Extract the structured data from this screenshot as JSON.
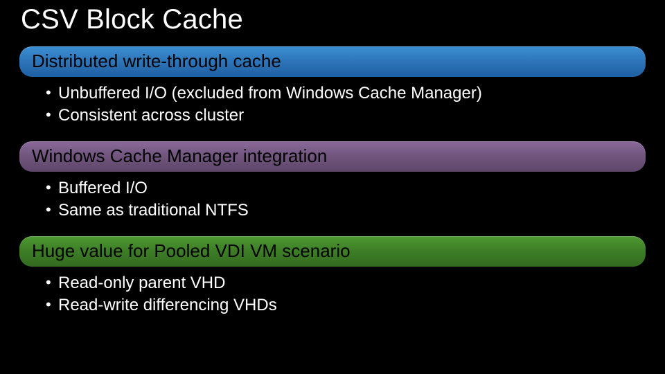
{
  "title": "CSV Block Cache",
  "sections": [
    {
      "heading": "Distributed write-through cache",
      "color": "blue",
      "bullets": [
        "Unbuffered I/O (excluded from Windows Cache Manager)",
        "Consistent across cluster"
      ]
    },
    {
      "heading": "Windows Cache Manager integration",
      "color": "purple",
      "bullets": [
        "Buffered I/O",
        "Same as traditional NTFS"
      ]
    },
    {
      "heading": "Huge value for Pooled VDI VM scenario",
      "color": "green",
      "bullets": [
        "Read-only parent VHD",
        "Read-write differencing VHDs"
      ]
    }
  ]
}
